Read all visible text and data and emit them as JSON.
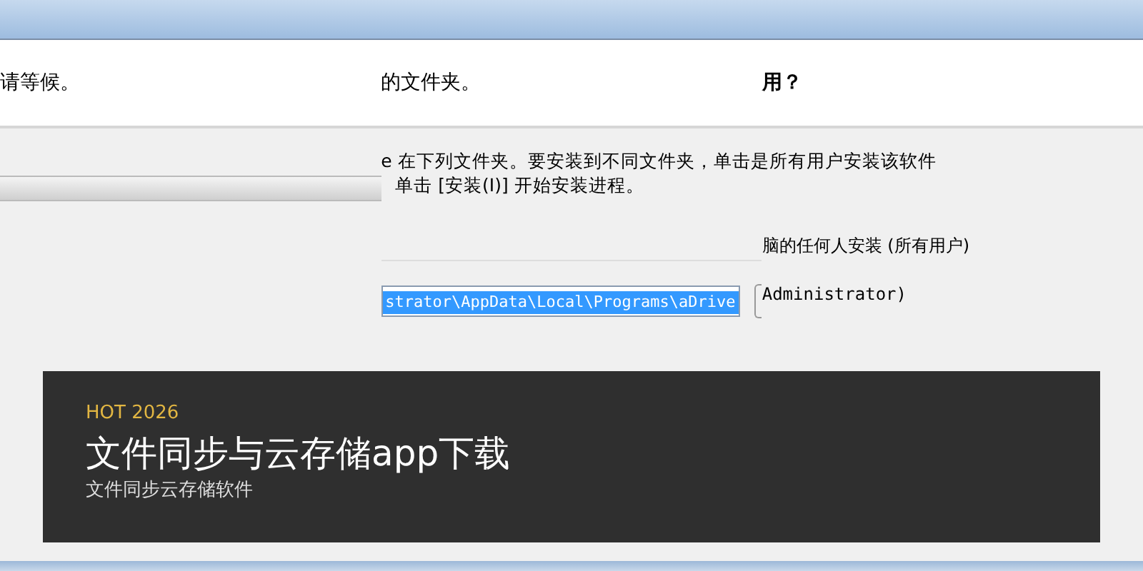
{
  "panels": [
    {
      "kind": "progress",
      "header": "请等候。",
      "progress": {
        "level": 1
      }
    },
    {
      "kind": "folder",
      "header": "的文件夹。",
      "lines": [
        "e 在下列文件夹。要安装到不同文件夹，单击是所有用户安装该软件",
        "单击 [安装(I)] 开始安装进程。"
      ],
      "path_field": {
        "value": "strator\\AppData\\Local\\Programs\\aDrive"
      }
    },
    {
      "kind": "options",
      "header": "用？",
      "lines": [
        "脑的任何人安装 (所有用户)",
        "Administrator)"
      ]
    }
  ],
  "banner": {
    "tag": "HOT 2026",
    "title": "文件同步与云存储app下载",
    "subtitle": "文件同步云存储软件"
  }
}
